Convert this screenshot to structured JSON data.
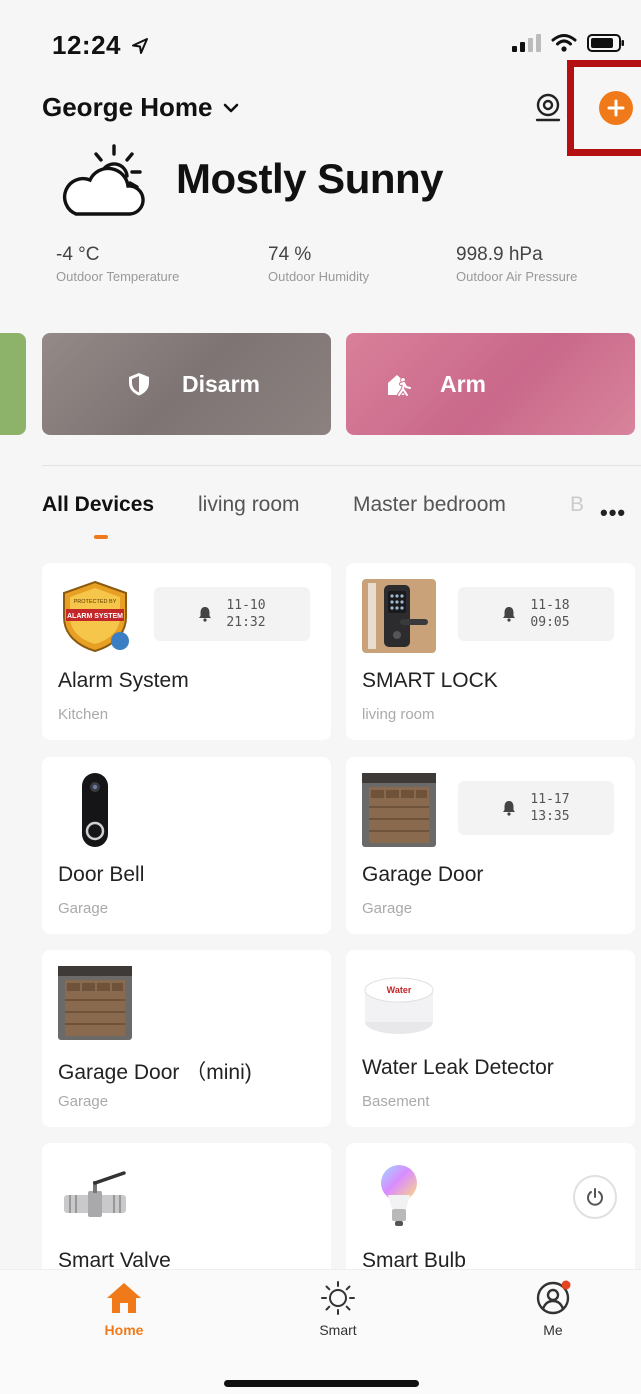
{
  "status_bar": {
    "time": "12:24"
  },
  "header": {
    "home_name": "George Home"
  },
  "weather": {
    "condition": "Mostly Sunny",
    "stats": [
      {
        "value": "-4 °C",
        "label": "Outdoor Temperature"
      },
      {
        "value": "74 %",
        "label": "Outdoor Humidity"
      },
      {
        "value": "998.9 hPa",
        "label": "Outdoor Air Pressure"
      }
    ]
  },
  "security": {
    "disarm_label": "Disarm",
    "arm_label": "Arm"
  },
  "tabs": [
    "All Devices",
    "living room",
    "Master bedroom",
    "B"
  ],
  "devices": [
    {
      "name": "Alarm System",
      "room": "Kitchen",
      "date": "11-10",
      "time": "21:32"
    },
    {
      "name": "SMART LOCK",
      "room": "living room",
      "date": "11-18",
      "time": "09:05"
    },
    {
      "name": "Door Bell",
      "room": "Garage"
    },
    {
      "name": "Garage Door",
      "room": "Garage",
      "date": "11-17",
      "time": "13:35"
    },
    {
      "name": "Garage Door （mini)",
      "room": "Garage"
    },
    {
      "name": "Water Leak Detector",
      "room": "Basement",
      "thumb_text": "Water"
    },
    {
      "name": "Smart Valve",
      "room": ""
    },
    {
      "name": "Smart Bulb",
      "room": ""
    }
  ],
  "alarm_thumb": {
    "top_text": "PROTECTED BY",
    "mid_text": "ALARM SYSTEM"
  },
  "nav": {
    "home": "Home",
    "smart": "Smart",
    "me": "Me"
  },
  "colors": {
    "accent": "#f07a19",
    "highlight_box": "#b40f12",
    "disarm": "#857c7b",
    "arm": "#d07592"
  }
}
